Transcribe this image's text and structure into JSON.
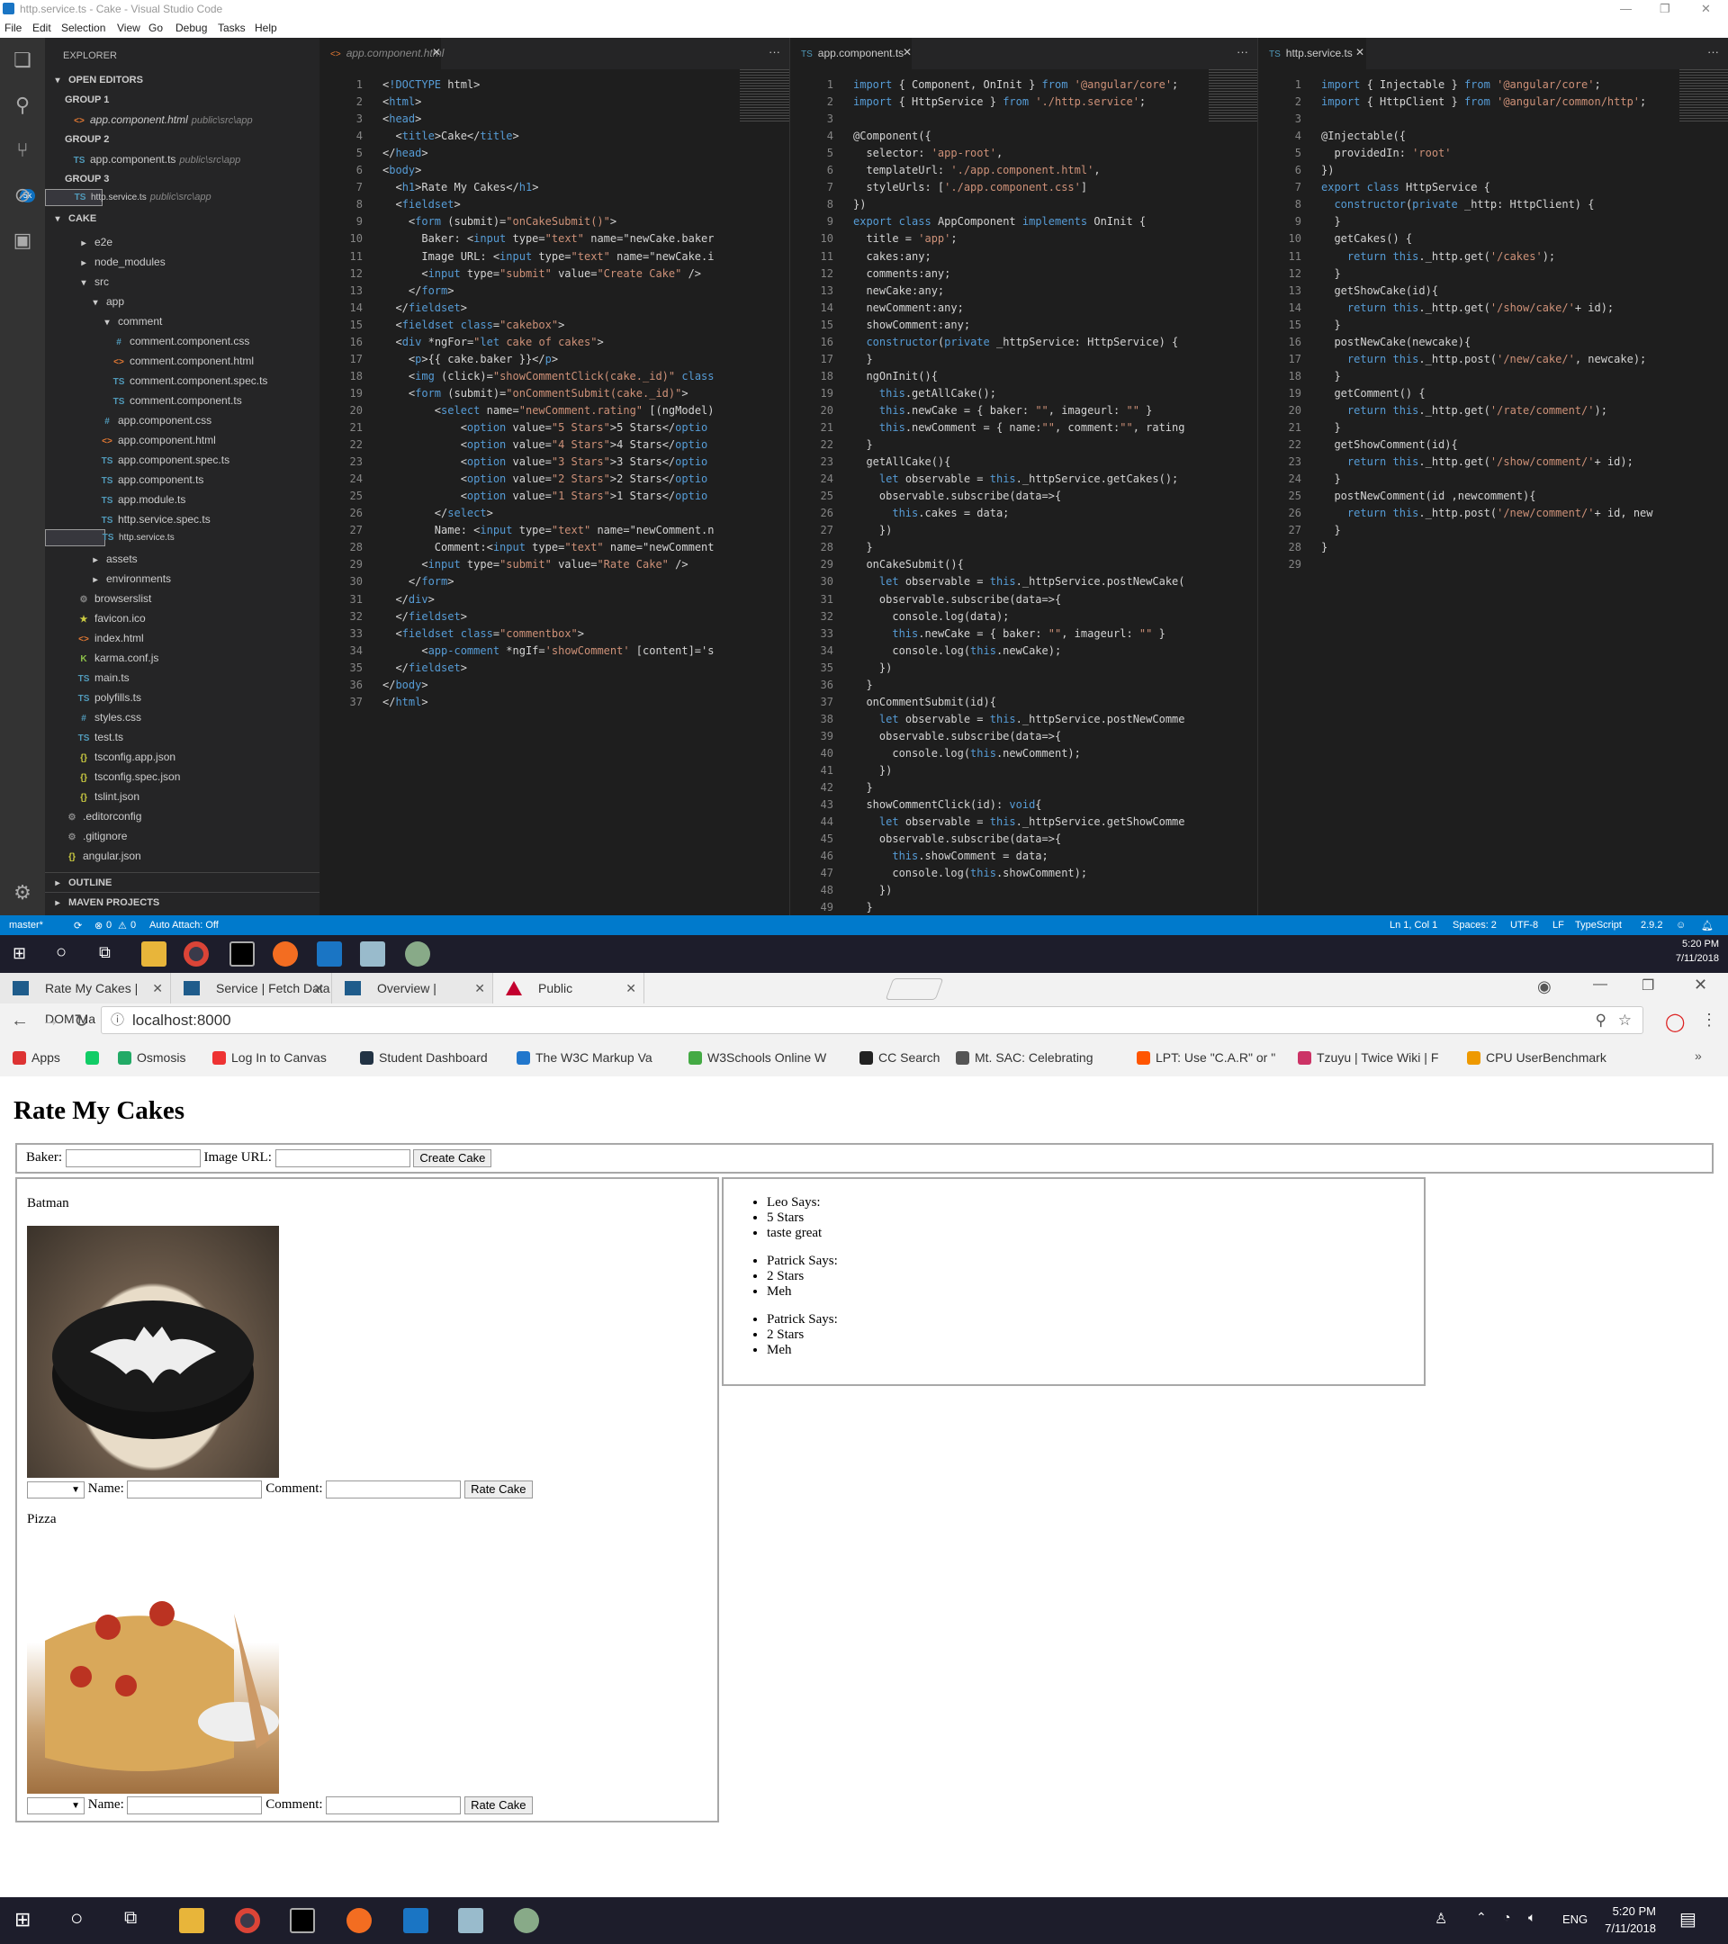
{
  "vscode": {
    "title": "http.service.ts - Cake - Visual Studio Code",
    "menu": [
      "File",
      "Edit",
      "Selection",
      "View",
      "Go",
      "Debug",
      "Tasks",
      "Help"
    ],
    "scm_badge": "5k",
    "explorer": {
      "header": "EXPLORER",
      "open_editors": "OPEN EDITORS",
      "groups": [
        {
          "name": "GROUP 1",
          "file": "app.component.html",
          "path": "public\\src\\app"
        },
        {
          "name": "GROUP 2",
          "file": "app.component.ts",
          "path": "public\\src\\app"
        },
        {
          "name": "GROUP 3",
          "file": "http.service.ts",
          "path": "public\\src\\app"
        }
      ],
      "project": "CAKE",
      "tree": [
        "e2e",
        "node_modules",
        "src",
        "app",
        "comment",
        "comment.component.css",
        "comment.component.html",
        "comment.component.spec.ts",
        "comment.component.ts",
        "app.component.css",
        "app.component.html",
        "app.component.spec.ts",
        "app.component.ts",
        "app.module.ts",
        "http.service.spec.ts",
        "http.service.ts",
        "assets",
        "environments",
        "browserslist",
        "favicon.ico",
        "index.html",
        "karma.conf.js",
        "main.ts",
        "polyfills.ts",
        "styles.css",
        "test.ts",
        "tsconfig.app.json",
        "tsconfig.spec.json",
        "tslint.json",
        ".editorconfig",
        ".gitignore",
        "angular.json"
      ],
      "outline": "OUTLINE",
      "maven": "MAVEN PROJECTS"
    },
    "editors": [
      {
        "tab": "app.component.html",
        "lines": [
          "<!DOCTYPE html>",
          "<html>",
          "<head>",
          "  <title>Cake</title>",
          "</head>",
          "<body>",
          "  <h1>Rate My Cakes</h1>",
          "  <fieldset>",
          "    <form (submit)=\"onCakeSubmit()\">",
          "      Baker: <input type=\"text\" name=\"newCake.baker",
          "      Image URL: <input type=\"text\" name=\"newCake.i",
          "      <input type=\"submit\" value=\"Create Cake\" />",
          "    </form>",
          "  </fieldset>",
          "  <fieldset class=\"cakebox\">",
          "  <div *ngFor=\"let cake of cakes\">",
          "    <p>{{ cake.baker }}</p>",
          "    <img (click)=\"showCommentClick(cake._id)\" class",
          "    <form (submit)=\"onCommentSubmit(cake._id)\">",
          "        <select name=\"newComment.rating\" [(ngModel)",
          "            <option value=\"5 Stars\">5 Stars</optio",
          "            <option value=\"4 Stars\">4 Stars</optio",
          "            <option value=\"3 Stars\">3 Stars</optio",
          "            <option value=\"2 Stars\">2 Stars</optio",
          "            <option value=\"1 Stars\">1 Stars</optio",
          "        </select>",
          "        Name: <input type=\"text\" name=\"newComment.n",
          "        Comment:<input type=\"text\" name=\"newComment",
          "      <input type=\"submit\" value=\"Rate Cake\" />",
          "    </form>",
          "  </div>",
          "  </fieldset>",
          "  <fieldset class=\"commentbox\">",
          "      <app-comment *ngIf='showComment' [content]='s",
          "  </fieldset>",
          "</body>",
          "</html>"
        ]
      },
      {
        "tab": "app.component.ts",
        "lines": [
          "import { Component, OnInit } from '@angular/core';",
          "import { HttpService } from './http.service';",
          "",
          "@Component({",
          "  selector: 'app-root',",
          "  templateUrl: './app.component.html',",
          "  styleUrls: ['./app.component.css']",
          "})",
          "export class AppComponent implements OnInit {",
          "  title = 'app';",
          "  cakes:any;",
          "  comments:any;",
          "  newCake:any;",
          "  newComment:any;",
          "  showComment:any;",
          "  constructor(private _httpService: HttpService) {",
          "  }",
          "  ngOnInit(){",
          "    this.getAllCake();",
          "    this.newCake = { baker: \"\", imageurl: \"\" }",
          "    this.newComment = { name:\"\", comment:\"\", rating",
          "  }",
          "  getAllCake(){",
          "    let observable = this._httpService.getCakes();",
          "    observable.subscribe(data=>{",
          "      this.cakes = data;",
          "    })",
          "  }",
          "  onCakeSubmit(){",
          "    let observable = this._httpService.postNewCake(",
          "    observable.subscribe(data=>{",
          "      console.log(data);",
          "      this.newCake = { baker: \"\", imageurl: \"\" }",
          "      console.log(this.newCake);",
          "    })",
          "  }",
          "  onCommentSubmit(id){",
          "    let observable = this._httpService.postNewComme",
          "    observable.subscribe(data=>{",
          "      console.log(this.newComment);",
          "    })",
          "  }",
          "  showCommentClick(id): void{",
          "    let observable = this._httpService.getShowComme",
          "    observable.subscribe(data=>{",
          "      this.showComment = data;",
          "      console.log(this.showComment);",
          "    })",
          "  }"
        ]
      },
      {
        "tab": "http.service.ts",
        "lines": [
          "import { Injectable } from '@angular/core';",
          "import { HttpClient } from '@angular/common/http';",
          "",
          "@Injectable({",
          "  providedIn: 'root'",
          "})",
          "export class HttpService {",
          "  constructor(private _http: HttpClient) {",
          "  }",
          "  getCakes() {",
          "    return this._http.get('/cakes');",
          "  }",
          "  getShowCake(id){",
          "    return this._http.get('/show/cake/'+ id);",
          "  }",
          "  postNewCake(newcake){",
          "    return this._http.post('/new/cake/', newcake);",
          "  }",
          "  getComment() {",
          "    return this._http.get('/rate/comment/');",
          "  }",
          "  getShowComment(id){",
          "    return this._http.get('/show/comment/'+ id);",
          "  }",
          "  postNewComment(id ,newcomment){",
          "    return this._http.post('/new/comment/'+ id, new",
          "  }",
          "}",
          ""
        ]
      }
    ],
    "status": {
      "branch": "master*",
      "errors": "0",
      "warnings": "0",
      "attach": "Auto Attach: Off",
      "pos": "Ln 1, Col 1",
      "spaces": "Spaces: 2",
      "enc": "UTF-8",
      "eol": "LF",
      "lang": "TypeScript",
      "ver": "2.9.2"
    }
  },
  "taskbar": {
    "time": "5:20 PM",
    "date": "7/11/2018",
    "lang": "ENG"
  },
  "chrome": {
    "tabs": [
      {
        "title": "Rate My Cakes | DOM Ma",
        "color": "#1f5c8b"
      },
      {
        "title": "Service | Fetch Data",
        "color": "#1f5c8b"
      },
      {
        "title": "Overview | Navigation",
        "color": "#1f5c8b"
      },
      {
        "title": "Public",
        "color": "#c3002f"
      }
    ],
    "url": "localhost:8000",
    "bookmarks": [
      {
        "label": "Apps",
        "color": "#d33"
      },
      {
        "label": "",
        "color": "#1c6"
      },
      {
        "label": "Osmosis",
        "color": "#2a6"
      },
      {
        "label": "Log In to Canvas",
        "color": "#e33"
      },
      {
        "label": "Student Dashboard",
        "color": "#234"
      },
      {
        "label": "The W3C Markup Va",
        "color": "#27c"
      },
      {
        "label": "W3Schools Online W",
        "color": "#4a4"
      },
      {
        "label": "CC Search",
        "color": "#222"
      },
      {
        "label": "Mt. SAC: Celebrating",
        "color": "#555"
      },
      {
        "label": "LPT: Use \"C.A.R\" or \"",
        "color": "#f50"
      },
      {
        "label": "Tzuyu | Twice Wiki | F",
        "color": "#c36"
      },
      {
        "label": "CPU UserBenchmark",
        "color": "#e90"
      }
    ]
  },
  "app": {
    "heading": "Rate My Cakes",
    "form": {
      "baker_label": "Baker:",
      "image_label": "Image URL:",
      "create_button": "Create Cake"
    },
    "cakes": [
      {
        "baker": "Batman",
        "name_label": "Name:",
        "comment_label": "Comment:",
        "rate_button": "Rate Cake"
      },
      {
        "baker": "Pizza",
        "name_label": "Name:",
        "comment_label": "Comment:",
        "rate_button": "Rate Cake"
      }
    ],
    "comments": [
      [
        "Leo Says:",
        "5 Stars",
        "taste great"
      ],
      [
        "Patrick Says:",
        "2 Stars",
        "Meh"
      ],
      [
        "Patrick Says:",
        "2 Stars",
        "Meh"
      ]
    ]
  }
}
